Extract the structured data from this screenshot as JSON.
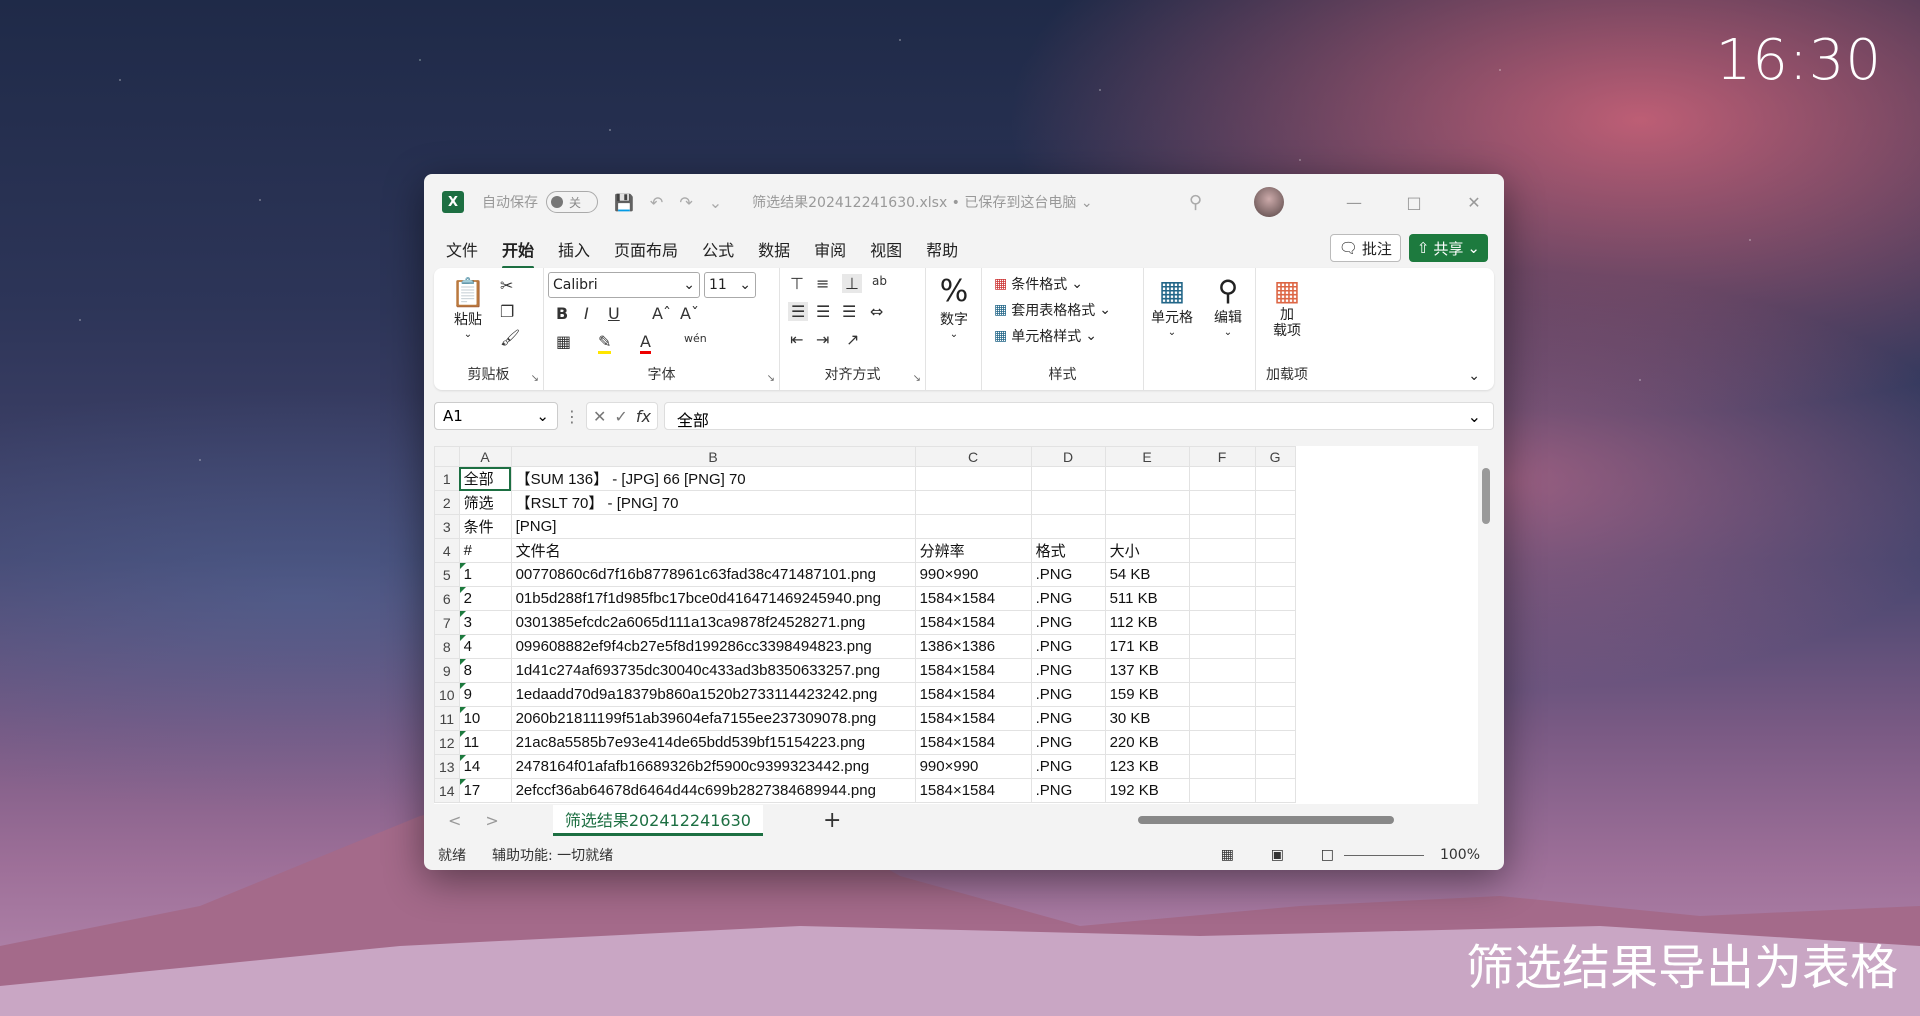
{
  "desktop": {
    "clock": "16:30",
    "caption": "筛选结果导出为表格"
  },
  "window": {
    "autosave_label": "自动保存",
    "autosave_state": "关",
    "filename": "筛选结果202412241630.xlsx • 已保存到这台电脑 ⌄",
    "menu": [
      "文件",
      "开始",
      "插入",
      "页面布局",
      "公式",
      "数据",
      "审阅",
      "视图",
      "帮助"
    ],
    "active_menu": "开始",
    "comment_btn": "批注",
    "share_btn": "共享"
  },
  "ribbon": {
    "paste": "粘贴",
    "clipboard": "剪贴板",
    "font_name": "Calibri",
    "font_size": "11",
    "font_group": "字体",
    "align_group": "对齐方式",
    "number": "数字",
    "cond_format": "条件格式",
    "table_format": "套用表格格式",
    "cell_style": "单元格样式",
    "style_group": "样式",
    "cells": "单元格",
    "edit": "编辑",
    "addin_btn": "加\n载项",
    "addin_group": "加载项"
  },
  "formula": {
    "namebox": "A1",
    "content": "全部"
  },
  "sheet": {
    "columns": [
      "A",
      "B",
      "C",
      "D",
      "E",
      "F",
      "G"
    ],
    "rows": [
      [
        "全部",
        "【SUM 136】 - [JPG] 66  [PNG] 70",
        "",
        "",
        ""
      ],
      [
        "筛选",
        "【RSLT 70】 - [PNG] 70",
        "",
        "",
        ""
      ],
      [
        "条件",
        "[PNG]",
        "",
        "",
        ""
      ],
      [
        "#",
        "文件名",
        "分辨率",
        "格式",
        "大小"
      ],
      [
        "1",
        "00770860c6d7f16b8778961c63fad38c471487101.png",
        "990×990",
        ".PNG",
        "54 KB"
      ],
      [
        "2",
        "01b5d288f17f1d985fbc17bce0d416471469245940.png",
        "1584×1584",
        ".PNG",
        "511 KB"
      ],
      [
        "3",
        "0301385efcdc2a6065d111a13ca9878f24528271.png",
        "1584×1584",
        ".PNG",
        "112 KB"
      ],
      [
        "4",
        "099608882ef9f4cb27e5f8d199286cc3398494823.png",
        "1386×1386",
        ".PNG",
        "171 KB"
      ],
      [
        "8",
        "1d41c274af693735dc30040c433ad3b8350633257.png",
        "1584×1584",
        ".PNG",
        "137 KB"
      ],
      [
        "9",
        "1edaadd70d9a18379b860a1520b2733114423242.png",
        "1584×1584",
        ".PNG",
        "159 KB"
      ],
      [
        "10",
        "2060b21811199f51ab39604efa7155ee237309078.png",
        "1584×1584",
        ".PNG",
        "30 KB"
      ],
      [
        "11",
        "21ac8a5585b7e93e414de65bdd539bf15154223.png",
        "1584×1584",
        ".PNG",
        "220 KB"
      ],
      [
        "14",
        "2478164f01afafb16689326b2f5900c9399323442.png",
        "990×990",
        ".PNG",
        "123 KB"
      ],
      [
        "17",
        "2efccf36ab64678d6464d44c699b2827384689944.png",
        "1584×1584",
        ".PNG",
        "192 KB"
      ]
    ],
    "tab_name": "筛选结果202412241630"
  },
  "status": {
    "ready": "就绪",
    "accessibility": "辅助功能: 一切就绪",
    "zoom": "100%"
  }
}
